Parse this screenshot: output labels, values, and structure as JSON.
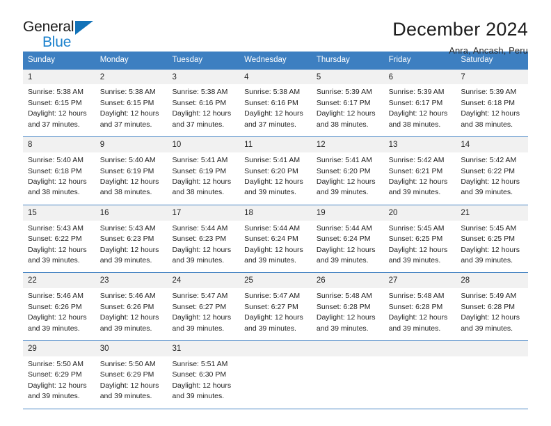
{
  "brand": {
    "word_top": "General",
    "word_bottom": "Blue",
    "triangle_color": "#1272b8",
    "blue_color": "#1b81cd"
  },
  "header": {
    "title": "December 2024",
    "subtitle": "Anra, Ancash, Peru"
  },
  "theme": {
    "header_row_bg": "#3d7fc1",
    "day_number_bg": "#f1f1f1",
    "week_separator": "#4a86c4",
    "text": "#232323"
  },
  "weekdays": [
    "Sunday",
    "Monday",
    "Tuesday",
    "Wednesday",
    "Thursday",
    "Friday",
    "Saturday"
  ],
  "weeks": [
    {
      "days": [
        {
          "num": "1",
          "sunrise": "Sunrise: 5:38 AM",
          "sunset": "Sunset: 6:15 PM",
          "daylight1": "Daylight: 12 hours",
          "daylight2": "and 37 minutes."
        },
        {
          "num": "2",
          "sunrise": "Sunrise: 5:38 AM",
          "sunset": "Sunset: 6:15 PM",
          "daylight1": "Daylight: 12 hours",
          "daylight2": "and 37 minutes."
        },
        {
          "num": "3",
          "sunrise": "Sunrise: 5:38 AM",
          "sunset": "Sunset: 6:16 PM",
          "daylight1": "Daylight: 12 hours",
          "daylight2": "and 37 minutes."
        },
        {
          "num": "4",
          "sunrise": "Sunrise: 5:38 AM",
          "sunset": "Sunset: 6:16 PM",
          "daylight1": "Daylight: 12 hours",
          "daylight2": "and 37 minutes."
        },
        {
          "num": "5",
          "sunrise": "Sunrise: 5:39 AM",
          "sunset": "Sunset: 6:17 PM",
          "daylight1": "Daylight: 12 hours",
          "daylight2": "and 38 minutes."
        },
        {
          "num": "6",
          "sunrise": "Sunrise: 5:39 AM",
          "sunset": "Sunset: 6:17 PM",
          "daylight1": "Daylight: 12 hours",
          "daylight2": "and 38 minutes."
        },
        {
          "num": "7",
          "sunrise": "Sunrise: 5:39 AM",
          "sunset": "Sunset: 6:18 PM",
          "daylight1": "Daylight: 12 hours",
          "daylight2": "and 38 minutes."
        }
      ]
    },
    {
      "days": [
        {
          "num": "8",
          "sunrise": "Sunrise: 5:40 AM",
          "sunset": "Sunset: 6:18 PM",
          "daylight1": "Daylight: 12 hours",
          "daylight2": "and 38 minutes."
        },
        {
          "num": "9",
          "sunrise": "Sunrise: 5:40 AM",
          "sunset": "Sunset: 6:19 PM",
          "daylight1": "Daylight: 12 hours",
          "daylight2": "and 38 minutes."
        },
        {
          "num": "10",
          "sunrise": "Sunrise: 5:41 AM",
          "sunset": "Sunset: 6:19 PM",
          "daylight1": "Daylight: 12 hours",
          "daylight2": "and 38 minutes."
        },
        {
          "num": "11",
          "sunrise": "Sunrise: 5:41 AM",
          "sunset": "Sunset: 6:20 PM",
          "daylight1": "Daylight: 12 hours",
          "daylight2": "and 39 minutes."
        },
        {
          "num": "12",
          "sunrise": "Sunrise: 5:41 AM",
          "sunset": "Sunset: 6:20 PM",
          "daylight1": "Daylight: 12 hours",
          "daylight2": "and 39 minutes."
        },
        {
          "num": "13",
          "sunrise": "Sunrise: 5:42 AM",
          "sunset": "Sunset: 6:21 PM",
          "daylight1": "Daylight: 12 hours",
          "daylight2": "and 39 minutes."
        },
        {
          "num": "14",
          "sunrise": "Sunrise: 5:42 AM",
          "sunset": "Sunset: 6:22 PM",
          "daylight1": "Daylight: 12 hours",
          "daylight2": "and 39 minutes."
        }
      ]
    },
    {
      "days": [
        {
          "num": "15",
          "sunrise": "Sunrise: 5:43 AM",
          "sunset": "Sunset: 6:22 PM",
          "daylight1": "Daylight: 12 hours",
          "daylight2": "and 39 minutes."
        },
        {
          "num": "16",
          "sunrise": "Sunrise: 5:43 AM",
          "sunset": "Sunset: 6:23 PM",
          "daylight1": "Daylight: 12 hours",
          "daylight2": "and 39 minutes."
        },
        {
          "num": "17",
          "sunrise": "Sunrise: 5:44 AM",
          "sunset": "Sunset: 6:23 PM",
          "daylight1": "Daylight: 12 hours",
          "daylight2": "and 39 minutes."
        },
        {
          "num": "18",
          "sunrise": "Sunrise: 5:44 AM",
          "sunset": "Sunset: 6:24 PM",
          "daylight1": "Daylight: 12 hours",
          "daylight2": "and 39 minutes."
        },
        {
          "num": "19",
          "sunrise": "Sunrise: 5:44 AM",
          "sunset": "Sunset: 6:24 PM",
          "daylight1": "Daylight: 12 hours",
          "daylight2": "and 39 minutes."
        },
        {
          "num": "20",
          "sunrise": "Sunrise: 5:45 AM",
          "sunset": "Sunset: 6:25 PM",
          "daylight1": "Daylight: 12 hours",
          "daylight2": "and 39 minutes."
        },
        {
          "num": "21",
          "sunrise": "Sunrise: 5:45 AM",
          "sunset": "Sunset: 6:25 PM",
          "daylight1": "Daylight: 12 hours",
          "daylight2": "and 39 minutes."
        }
      ]
    },
    {
      "days": [
        {
          "num": "22",
          "sunrise": "Sunrise: 5:46 AM",
          "sunset": "Sunset: 6:26 PM",
          "daylight1": "Daylight: 12 hours",
          "daylight2": "and 39 minutes."
        },
        {
          "num": "23",
          "sunrise": "Sunrise: 5:46 AM",
          "sunset": "Sunset: 6:26 PM",
          "daylight1": "Daylight: 12 hours",
          "daylight2": "and 39 minutes."
        },
        {
          "num": "24",
          "sunrise": "Sunrise: 5:47 AM",
          "sunset": "Sunset: 6:27 PM",
          "daylight1": "Daylight: 12 hours",
          "daylight2": "and 39 minutes."
        },
        {
          "num": "25",
          "sunrise": "Sunrise: 5:47 AM",
          "sunset": "Sunset: 6:27 PM",
          "daylight1": "Daylight: 12 hours",
          "daylight2": "and 39 minutes."
        },
        {
          "num": "26",
          "sunrise": "Sunrise: 5:48 AM",
          "sunset": "Sunset: 6:28 PM",
          "daylight1": "Daylight: 12 hours",
          "daylight2": "and 39 minutes."
        },
        {
          "num": "27",
          "sunrise": "Sunrise: 5:48 AM",
          "sunset": "Sunset: 6:28 PM",
          "daylight1": "Daylight: 12 hours",
          "daylight2": "and 39 minutes."
        },
        {
          "num": "28",
          "sunrise": "Sunrise: 5:49 AM",
          "sunset": "Sunset: 6:28 PM",
          "daylight1": "Daylight: 12 hours",
          "daylight2": "and 39 minutes."
        }
      ]
    },
    {
      "days": [
        {
          "num": "29",
          "sunrise": "Sunrise: 5:50 AM",
          "sunset": "Sunset: 6:29 PM",
          "daylight1": "Daylight: 12 hours",
          "daylight2": "and 39 minutes."
        },
        {
          "num": "30",
          "sunrise": "Sunrise: 5:50 AM",
          "sunset": "Sunset: 6:29 PM",
          "daylight1": "Daylight: 12 hours",
          "daylight2": "and 39 minutes."
        },
        {
          "num": "31",
          "sunrise": "Sunrise: 5:51 AM",
          "sunset": "Sunset: 6:30 PM",
          "daylight1": "Daylight: 12 hours",
          "daylight2": "and 39 minutes."
        },
        {
          "num": "",
          "sunrise": "",
          "sunset": "",
          "daylight1": "",
          "daylight2": ""
        },
        {
          "num": "",
          "sunrise": "",
          "sunset": "",
          "daylight1": "",
          "daylight2": ""
        },
        {
          "num": "",
          "sunrise": "",
          "sunset": "",
          "daylight1": "",
          "daylight2": ""
        },
        {
          "num": "",
          "sunrise": "",
          "sunset": "",
          "daylight1": "",
          "daylight2": ""
        }
      ]
    }
  ]
}
